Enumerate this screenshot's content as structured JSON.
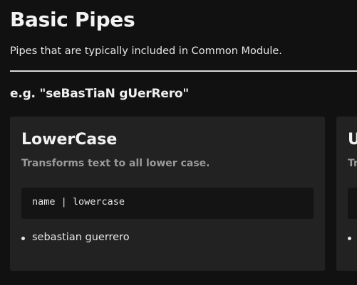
{
  "page": {
    "title": "Basic Pipes",
    "subtitle": "Pipes that are typically included in Common Module.",
    "example": "e.g. \"seBasTiaN gUerRero\""
  },
  "cards": [
    {
      "title": "LowerCase",
      "description": "Transforms text to all lower case.",
      "code": "name | lowercase",
      "result": "sebastian guerrero"
    },
    {
      "title": "U",
      "description": "Tr",
      "code": "",
      "result": ""
    }
  ]
}
